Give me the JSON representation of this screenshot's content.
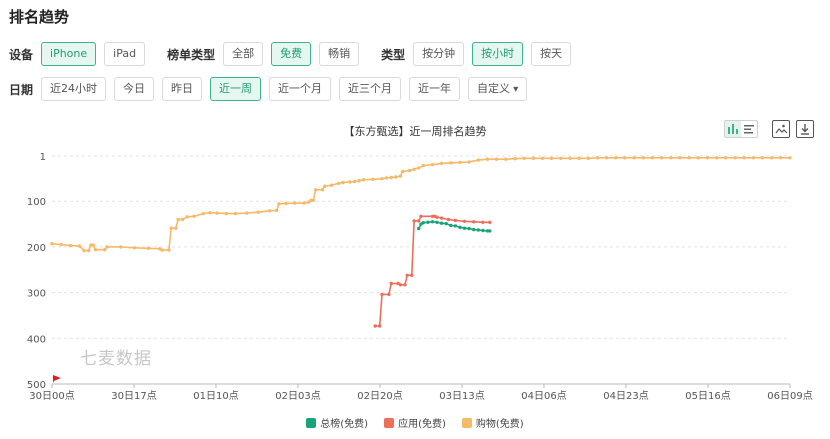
{
  "page_title": "排名趋势",
  "filters": {
    "device": {
      "label": "设备",
      "options": [
        "iPhone",
        "iPad"
      ],
      "active": 0
    },
    "list_type": {
      "label": "榜单类型",
      "options": [
        "全部",
        "免费",
        "畅销"
      ],
      "active": 1
    },
    "granularity": {
      "label": "类型",
      "options": [
        "按分钟",
        "按小时",
        "按天"
      ],
      "active": 1
    },
    "date": {
      "label": "日期",
      "options": [
        "近24小时",
        "今日",
        "昨日",
        "近一周",
        "近一个月",
        "近三个月",
        "近一年"
      ],
      "active": 3,
      "custom": "自定义"
    }
  },
  "watermark": "七麦数据",
  "chart_data": {
    "type": "line",
    "title": "【东方甄选】近一周排名趋势",
    "y_axis": {
      "inverted": true,
      "range": [
        1,
        500
      ],
      "ticks": [
        1,
        100,
        200,
        300,
        400,
        500
      ]
    },
    "x_axis": {
      "start": "30日00点",
      "end": "06日09点",
      "ticks": [
        "30日00点",
        "30日17点",
        "01日10点",
        "02日03点",
        "02日20点",
        "03日13点",
        "04日06点",
        "04日23点",
        "05日16点",
        "06日09点"
      ]
    },
    "grid": "horizontal dashed",
    "legend_position": "bottom-center",
    "series": [
      {
        "name": "总榜(免费)",
        "color": "#1aa37a",
        "points": [
          [
            160,
            160
          ],
          [
            161,
            150
          ],
          [
            162,
            147
          ],
          [
            164,
            146
          ],
          [
            166,
            145
          ],
          [
            168,
            146
          ],
          [
            170,
            148
          ],
          [
            172,
            149
          ],
          [
            174,
            153
          ],
          [
            176,
            154
          ],
          [
            178,
            157
          ],
          [
            180,
            159
          ],
          [
            182,
            160
          ],
          [
            184,
            162
          ],
          [
            186,
            163
          ],
          [
            188,
            164
          ],
          [
            190,
            165
          ],
          [
            191,
            165
          ]
        ]
      },
      {
        "name": "应用(免费)",
        "color": "#ee6e5c",
        "points": [
          [
            141,
            373
          ],
          [
            143,
            373
          ],
          [
            144,
            304
          ],
          [
            147,
            304
          ],
          [
            148,
            280
          ],
          [
            151,
            280
          ],
          [
            152,
            283
          ],
          [
            154,
            283
          ],
          [
            155,
            262
          ],
          [
            157,
            262
          ],
          [
            158,
            143
          ],
          [
            160,
            143
          ],
          [
            161,
            133
          ],
          [
            166,
            133
          ],
          [
            167,
            133
          ],
          [
            168,
            135
          ],
          [
            170,
            137
          ],
          [
            173,
            140
          ],
          [
            176,
            142
          ],
          [
            180,
            144
          ],
          [
            184,
            145
          ],
          [
            188,
            146
          ],
          [
            191,
            146
          ]
        ]
      },
      {
        "name": "购物(免费)",
        "color": "#f5b96a",
        "points": [
          [
            0,
            193
          ],
          [
            4,
            195
          ],
          [
            8,
            197
          ],
          [
            12,
            198
          ],
          [
            14,
            208
          ],
          [
            16,
            208
          ],
          [
            17,
            196
          ],
          [
            18,
            196
          ],
          [
            19,
            206
          ],
          [
            23,
            206
          ],
          [
            24,
            200
          ],
          [
            30,
            200
          ],
          [
            36,
            202
          ],
          [
            42,
            203
          ],
          [
            47,
            204
          ],
          [
            48,
            207
          ],
          [
            51,
            207
          ],
          [
            52,
            159
          ],
          [
            54,
            159
          ],
          [
            55,
            140
          ],
          [
            57,
            140
          ],
          [
            59,
            134
          ],
          [
            62,
            133
          ],
          [
            66,
            127
          ],
          [
            69,
            125
          ],
          [
            72,
            126
          ],
          [
            76,
            127
          ],
          [
            80,
            127
          ],
          [
            85,
            126
          ],
          [
            90,
            124
          ],
          [
            95,
            121
          ],
          [
            98,
            120
          ],
          [
            99,
            106
          ],
          [
            102,
            105
          ],
          [
            106,
            104
          ],
          [
            110,
            104
          ],
          [
            112,
            102
          ],
          [
            113,
            98
          ],
          [
            114,
            98
          ],
          [
            115,
            75
          ],
          [
            118,
            75
          ],
          [
            119,
            67
          ],
          [
            122,
            65
          ],
          [
            125,
            61
          ],
          [
            127,
            59
          ],
          [
            130,
            58
          ],
          [
            132,
            57
          ],
          [
            134,
            55
          ],
          [
            136,
            53
          ],
          [
            140,
            52
          ],
          [
            144,
            51
          ],
          [
            146,
            49
          ],
          [
            148,
            48
          ],
          [
            150,
            47
          ],
          [
            152,
            45
          ],
          [
            153,
            35
          ],
          [
            156,
            33
          ],
          [
            158,
            30
          ],
          [
            160,
            27
          ],
          [
            162,
            22
          ],
          [
            166,
            20
          ],
          [
            170,
            17
          ],
          [
            174,
            16
          ],
          [
            178,
            15
          ],
          [
            182,
            14
          ],
          [
            186,
            10
          ],
          [
            190,
            8
          ],
          [
            194,
            8
          ],
          [
            198,
            8
          ],
          [
            202,
            7
          ],
          [
            206,
            6
          ],
          [
            210,
            6
          ],
          [
            214,
            6
          ],
          [
            218,
            6
          ],
          [
            222,
            6
          ],
          [
            226,
            6
          ],
          [
            230,
            6
          ],
          [
            234,
            6
          ],
          [
            238,
            5
          ],
          [
            242,
            5
          ],
          [
            246,
            5
          ],
          [
            250,
            5
          ],
          [
            254,
            5
          ],
          [
            258,
            5
          ],
          [
            262,
            5
          ],
          [
            266,
            5
          ],
          [
            270,
            5
          ],
          [
            274,
            5
          ],
          [
            278,
            5
          ],
          [
            282,
            5
          ],
          [
            286,
            5
          ],
          [
            290,
            5
          ],
          [
            294,
            5
          ],
          [
            298,
            5
          ],
          [
            302,
            5
          ],
          [
            306,
            5
          ],
          [
            310,
            5
          ],
          [
            314,
            5
          ],
          [
            318,
            5
          ],
          [
            322,
            5
          ]
        ]
      }
    ]
  }
}
